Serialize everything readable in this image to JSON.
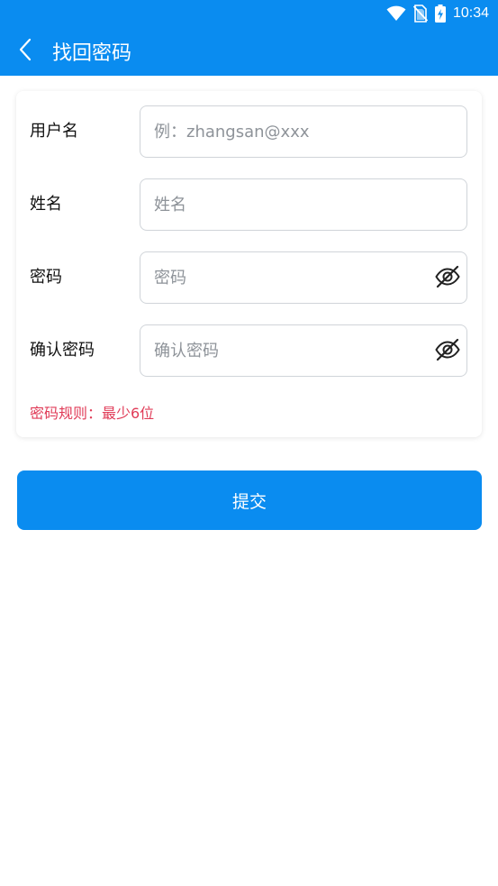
{
  "status_bar": {
    "time": "10:34",
    "icons": [
      "wifi-icon",
      "no-sim-icon",
      "battery-charging-icon"
    ]
  },
  "header": {
    "back_icon": "chevron-left-icon",
    "title": "找回密码"
  },
  "form": {
    "username": {
      "label": "用户名",
      "placeholder": "例：zhangsan@xxx",
      "value": ""
    },
    "name": {
      "label": "姓名",
      "placeholder": "姓名",
      "value": ""
    },
    "password": {
      "label": "密码",
      "placeholder": "密码",
      "value": "",
      "toggle_icon": "eye-off-icon"
    },
    "confirm_password": {
      "label": "确认密码",
      "placeholder": "确认密码",
      "value": "",
      "toggle_icon": "eye-off-icon"
    },
    "hint": "密码规则：最少6位"
  },
  "submit_label": "提交",
  "colors": {
    "primary": "#0a8cf0",
    "hint": "#e03b57",
    "border": "#d0d4d9",
    "placeholder": "#8e9399"
  }
}
